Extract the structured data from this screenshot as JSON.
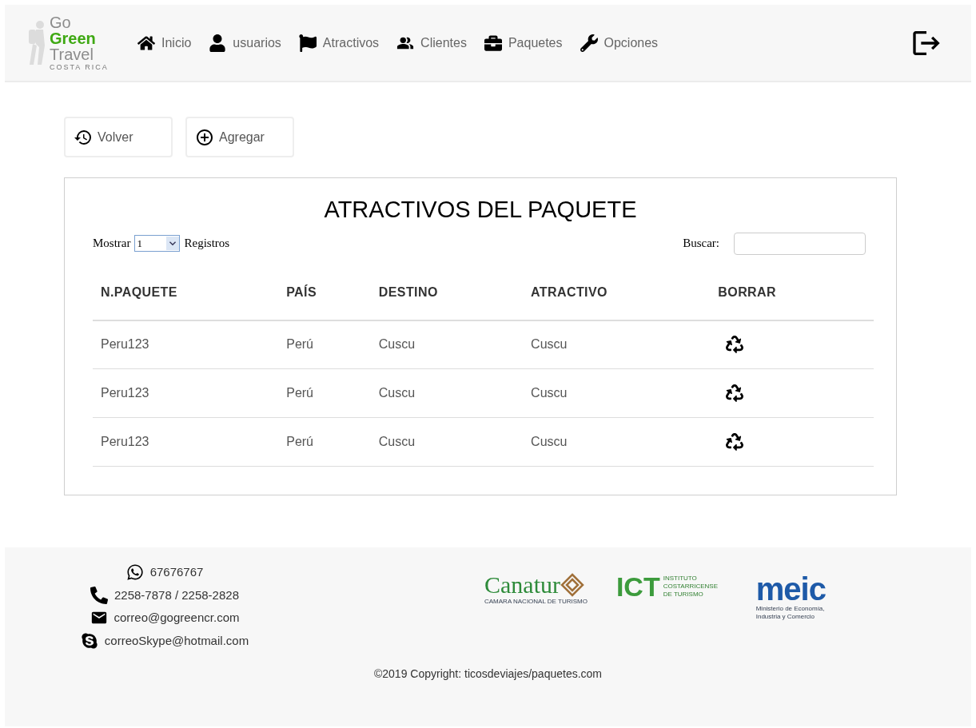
{
  "logo": {
    "line_1": "Go",
    "line_2": "Green",
    "line_3": "Travel",
    "tagline": "COSTA RICA"
  },
  "nav": [
    {
      "kind": "home",
      "label": "Inicio"
    },
    {
      "kind": "user",
      "label": "usuarios"
    },
    {
      "kind": "flag",
      "label": "Atractivos"
    },
    {
      "kind": "people",
      "label": "Clientes"
    },
    {
      "kind": "briefcase",
      "label": "Paquetes"
    },
    {
      "kind": "wrench",
      "label": "Opciones"
    }
  ],
  "actions": [
    {
      "kind": "back",
      "label": "Volver"
    },
    {
      "kind": "add",
      "label": "Agregar"
    }
  ],
  "panel": {
    "title": "ATRACTIVOS DEL PAQUETE",
    "show_label": "Mostrar",
    "show_value": "1",
    "show_suffix": "Registros",
    "search_label": "Buscar:"
  },
  "table": {
    "columns": [
      "N.PAQUETE",
      "PAÍS",
      "DESTINO",
      "ATRACTIVO",
      "BORRAR"
    ],
    "rows": [
      [
        "Peru123",
        "Perú",
        "Cuscu",
        "Cuscu"
      ],
      [
        "Peru123",
        "Perú",
        "Cuscu",
        "Cuscu"
      ],
      [
        "Peru123",
        "Perú",
        "Cuscu",
        "Cuscu"
      ]
    ]
  },
  "footer": {
    "contacts": [
      {
        "kind": "whatsapp",
        "text": "67676767"
      },
      {
        "kind": "phone",
        "text": "2258-7878 / 2258-2828"
      },
      {
        "kind": "mail",
        "text": "correo@gogreencr.com"
      },
      {
        "kind": "skype",
        "text": "correoSkype@hotmail.com"
      }
    ],
    "logos": [
      {
        "kind": "canatur",
        "name": "Canatur",
        "caption": "CAMARA NACIONAL DE TURISMO"
      },
      {
        "kind": "ict",
        "name": "ICT",
        "caption": "INSTITUTO COSTARRICENSE DE TURISMO"
      },
      {
        "kind": "meic",
        "name": "meic",
        "caption": "Ministerio de Economía, Industria y Comercio"
      }
    ],
    "copyright": "©2019 Copyright: ticosdeviajes/paquetes.com"
  }
}
